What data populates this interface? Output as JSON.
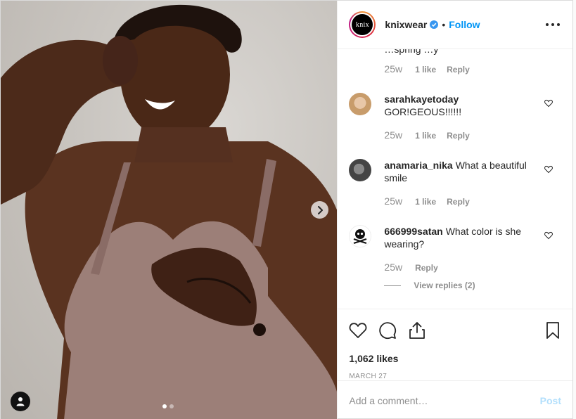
{
  "header": {
    "username": "knixwear",
    "logo_text": "knix",
    "separator": "•",
    "follow_label": "Follow"
  },
  "comments": {
    "clipped_fragment": "…spring  …y",
    "first_meta": {
      "time": "25w",
      "likes": "1 like",
      "reply": "Reply"
    },
    "items": [
      {
        "user": "sarahkayetoday",
        "text": "GOR!GEOUS!!!!!!",
        "time": "25w",
        "likes": "1 like",
        "reply": "Reply"
      },
      {
        "user": "anamaria_nika",
        "text": "What a beautiful smile",
        "time": "25w",
        "likes": "1 like",
        "reply": "Reply"
      },
      {
        "user": "666999satan",
        "text": "What color is she wearing?",
        "time": "25w",
        "likes": "",
        "reply": "Reply"
      }
    ],
    "view_replies": "View replies (2)"
  },
  "post": {
    "likes": "1,062 likes",
    "date": "MARCH 27"
  },
  "add_comment": {
    "placeholder": "Add a comment…",
    "post_label": "Post"
  },
  "carousel": {
    "count": 2,
    "active": 0
  },
  "colors": {
    "link": "#0095f6",
    "muted": "#8e8e8e",
    "text": "#262626",
    "post_disabled": "#b2dffc"
  },
  "icons": [
    "chevron-right-icon",
    "user-tag-icon",
    "verified-badge-icon",
    "more-icon",
    "heart-icon",
    "comment-icon",
    "share-icon",
    "bookmark-icon"
  ]
}
